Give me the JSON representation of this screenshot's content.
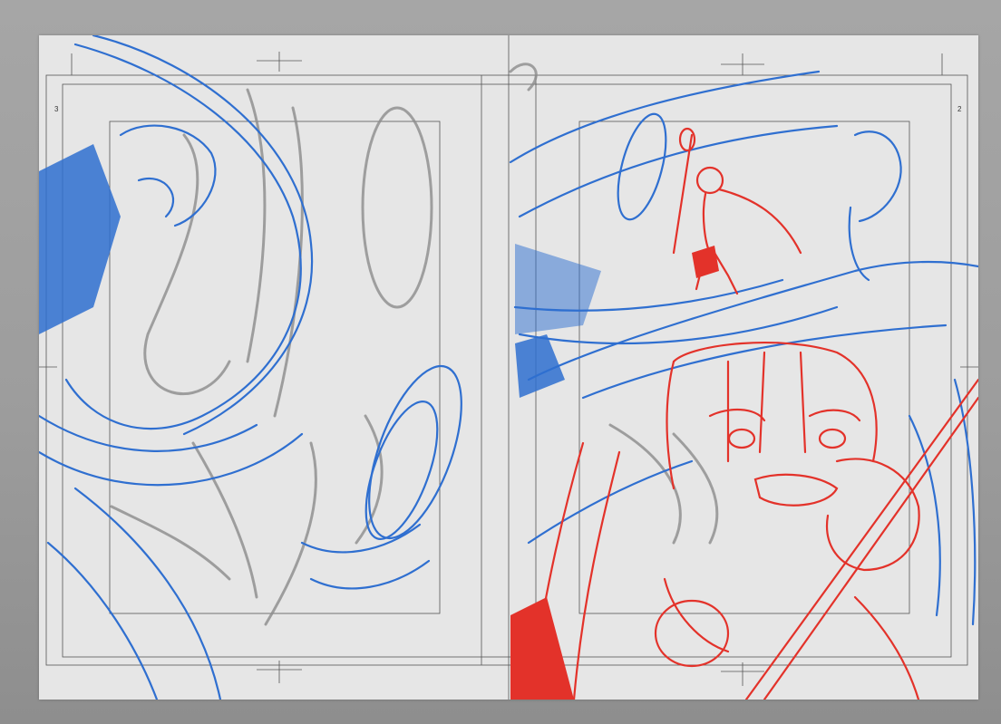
{
  "canvas": {
    "background_color": "#a3a3a3",
    "paper_color": "#e6e6e6",
    "guide_color": "#5a5a5a",
    "sketch_colors": {
      "blue": "#2f6fd0",
      "red": "#e3322a",
      "gray": "#8c8c8c"
    }
  },
  "pages": {
    "left": {
      "number": "3"
    },
    "right": {
      "number": "2"
    }
  }
}
